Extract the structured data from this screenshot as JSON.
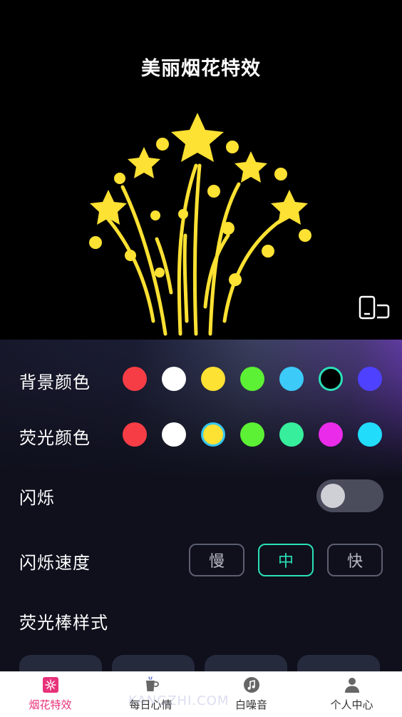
{
  "header": {
    "title": "美丽烟花特效"
  },
  "background_color": {
    "label": "背景颜色",
    "options": [
      "#f63d45",
      "#ffffff",
      "#fde133",
      "#5cf134",
      "#3ccbf9",
      "#000000",
      "#4e41ff"
    ],
    "selected": "#000000"
  },
  "glow_color": {
    "label": "荧光颜色",
    "options": [
      "#f63d45",
      "#ffffff",
      "#fde133",
      "#5cf134",
      "#37ee9d",
      "#ea2bea",
      "#21dcfb"
    ],
    "selected": "#fde133"
  },
  "blink": {
    "label": "闪烁",
    "enabled": false
  },
  "blink_speed": {
    "label": "闪烁速度",
    "options": [
      "慢",
      "中",
      "快"
    ],
    "selected": "中"
  },
  "stick_style": {
    "label": "荧光棒样式"
  },
  "tabbar": {
    "tabs": [
      {
        "label": "烟花特效",
        "icon": "firework-icon",
        "active": true
      },
      {
        "label": "每日心情",
        "icon": "cup-icon",
        "active": false
      },
      {
        "label": "白噪音",
        "icon": "music-note-icon",
        "active": false
      },
      {
        "label": "个人中心",
        "icon": "person-icon",
        "active": false
      }
    ],
    "watermark": "KANGZHI.COM"
  },
  "colors": {
    "accent": "#2be0b8",
    "active_tab": "#e8317a",
    "firework": "#fde133"
  }
}
